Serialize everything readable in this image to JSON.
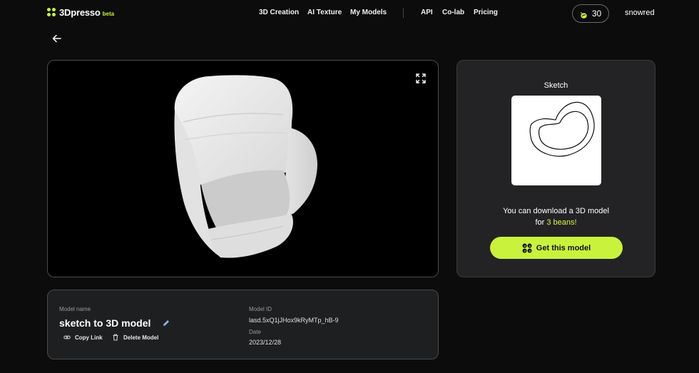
{
  "brand": {
    "name": "3Dpresso",
    "tag": "beta",
    "accent": "#c6f23b"
  },
  "nav": {
    "items": [
      "3D Creation",
      "AI Texture",
      "My Models"
    ],
    "items2": [
      "API",
      "Co-lab",
      "Pricing"
    ]
  },
  "account": {
    "beans": "30",
    "username": "snowred"
  },
  "icons": {
    "back": "arrow-left-icon",
    "expand": "fullscreen-icon",
    "edit": "pencil-icon",
    "copy": "link-icon",
    "delete": "trash-icon",
    "bean": "bean-icon"
  },
  "sketch": {
    "label": "Sketch",
    "download_text": "You can download a 3D model",
    "for_text": "for",
    "price_text": "3 beans!",
    "button_label": "Get this model"
  },
  "model": {
    "name_label": "Model name",
    "name": "sketch to 3D model",
    "copy_label": "Copy Link",
    "delete_label": "Delete Model",
    "id_label": "Model ID",
    "id": "lasd.5xQ1jJHox9kRyMTp_hB-9",
    "date_label": "Date",
    "date": "2023/12/28"
  }
}
